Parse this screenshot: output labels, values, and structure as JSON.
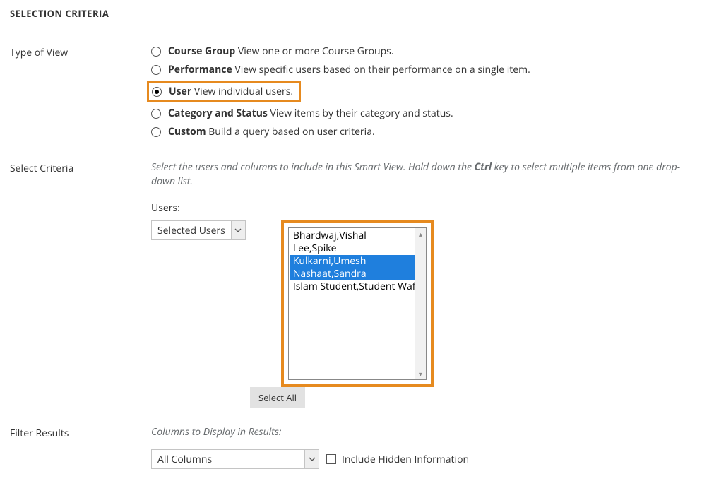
{
  "section_title": "SELECTION CRITERIA",
  "labels": {
    "type_of_view": "Type of View",
    "select_criteria": "Select Criteria",
    "filter_results": "Filter Results"
  },
  "view_options": [
    {
      "title": "Course Group",
      "desc": "View one or more Course Groups.",
      "checked": false,
      "highlighted": false
    },
    {
      "title": "Performance",
      "desc": "View specific users based on their performance on a single item.",
      "checked": false,
      "highlighted": false
    },
    {
      "title": "User",
      "desc": "View individual users.",
      "checked": true,
      "highlighted": true
    },
    {
      "title": "Category and Status",
      "desc": "View items by their category and status.",
      "checked": false,
      "highlighted": false
    },
    {
      "title": "Custom",
      "desc": "Build a query based on user criteria.",
      "checked": false,
      "highlighted": false
    }
  ],
  "criteria": {
    "help_pre": "Select the users and columns to include in this Smart View. Hold down the ",
    "help_bold": "Ctrl",
    "help_post": " key to select multiple items from one drop-down list.",
    "users_label": "Users:",
    "mode_selected": "Selected Users",
    "list": [
      {
        "name": "Bhardwaj,Vishal",
        "selected": false
      },
      {
        "name": "Lee,Spike",
        "selected": false
      },
      {
        "name": "Kulkarni,Umesh",
        "selected": true
      },
      {
        "name": "Nashaat,Sandra",
        "selected": true
      },
      {
        "name": "Islam Student,Student Wafa",
        "selected": false
      }
    ],
    "select_all_label": "Select All"
  },
  "filter": {
    "columns_label": "Columns to Display in Results:",
    "columns_selected": "All Columns",
    "hidden_label": "Include Hidden Information"
  }
}
